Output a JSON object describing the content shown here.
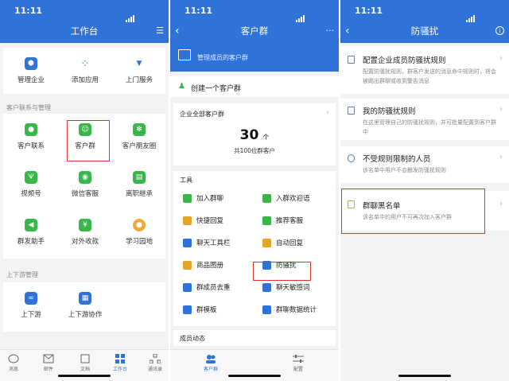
{
  "status_time": "11:11",
  "colors": {
    "brand": "#2f73d8",
    "highlight": "#e0332e"
  },
  "p1": {
    "title": "工作台",
    "top_items": [
      "管理企业",
      "添加应用",
      "上门服务"
    ],
    "section1": "客户联系与管理",
    "grid": [
      "客户联系",
      "客户群",
      "客户朋友圈",
      "视频号",
      "微信客服",
      "离职继承",
      "群发助手",
      "对外收款",
      "学习园地"
    ],
    "section2": "上下游管理",
    "grid2": [
      "上下游",
      "上下游协作"
    ],
    "tabs": [
      "消息",
      "邮件",
      "文档",
      "工作台",
      "通讯录"
    ]
  },
  "p2": {
    "title": "客户群",
    "banner": "管理成员的客户群",
    "create": "创建一个客户群",
    "all_label": "企业全部客户群",
    "count": "30",
    "count_unit": "个",
    "count_sub": "共100位群客户",
    "tools_label": "工具",
    "tools": [
      "加入群聊",
      "入群欢迎语",
      "快捷回复",
      "推荐客服",
      "聊天工具栏",
      "自动回复",
      "商品图册",
      "防骚扰",
      "群成员去重",
      "聊天敏感词",
      "群模板",
      "群聊数据统计"
    ],
    "dyn_label": "成员动态",
    "tabs": [
      "客户群",
      "配置"
    ]
  },
  "p3": {
    "title": "防骚扰",
    "rows": [
      {
        "title": "配置企业成员防骚扰规则",
        "desc": "配置防骚扰规则，群客户发送的消息命中规则时，将会被踢出群聊或收到警告消息"
      },
      {
        "title": "我的防骚扰规则",
        "desc": "在这里管理自己的防骚扰规则，并可批量配置到客户群中"
      },
      {
        "title": "不受规则限制的人员",
        "desc": "该名单中用户不会触发防骚扰规则"
      },
      {
        "title": "群聊黑名单",
        "desc": "该名单中的用户不可再次加入客户群"
      }
    ]
  }
}
